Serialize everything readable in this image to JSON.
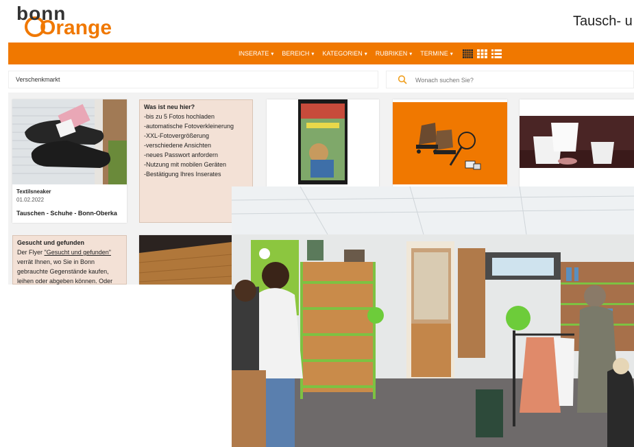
{
  "logo": {
    "line1": "bonn",
    "line2": "Orange"
  },
  "site_title": "Tausch- u",
  "nav": {
    "items": [
      {
        "label": "INSERATE"
      },
      {
        "label": "BEREICH"
      },
      {
        "label": "KATEGORIEN"
      },
      {
        "label": "RUBRIKEN"
      },
      {
        "label": "TERMINE"
      }
    ],
    "caret": "▾",
    "view_icons": [
      "grid-large-icon",
      "grid-small-icon",
      "list-view-icon"
    ]
  },
  "breadcrumb": "Verschenkmarkt",
  "search": {
    "placeholder": "Wonach suchen Sie?",
    "icon": "search-icon"
  },
  "cards": {
    "first": {
      "title": "Textilsneaker",
      "date": "01.02.2022",
      "subtitle": "Tauschen - Schuhe - Bonn-Oberka"
    }
  },
  "info_new": {
    "heading": "Was ist neu hier?",
    "lines": [
      "-bis zu 5 Fotos hochladen",
      "-automatische Fotoverkleinerung",
      "-XXL-Fotovergrößerung",
      "-verschiedene Ansichten",
      "-neues Passwort anfordern",
      "-Nutzung mit mobilen Geräten",
      "-Bestätigung Ihres Inserates"
    ]
  },
  "info_flyer": {
    "heading": "Gesucht und gefunden",
    "pre": "Der Flyer ",
    "link": "\"Gesucht und gefunden\"",
    "lines": [
      "verrät Ihnen, wo Sie in Bonn",
      "gebrauchte Gegenstände kaufen,",
      "leihen oder abgeben können. Oder"
    ]
  },
  "colors": {
    "accent": "#f07800",
    "info_bg": "#f3e1d6",
    "store_green": "#7dc242"
  }
}
